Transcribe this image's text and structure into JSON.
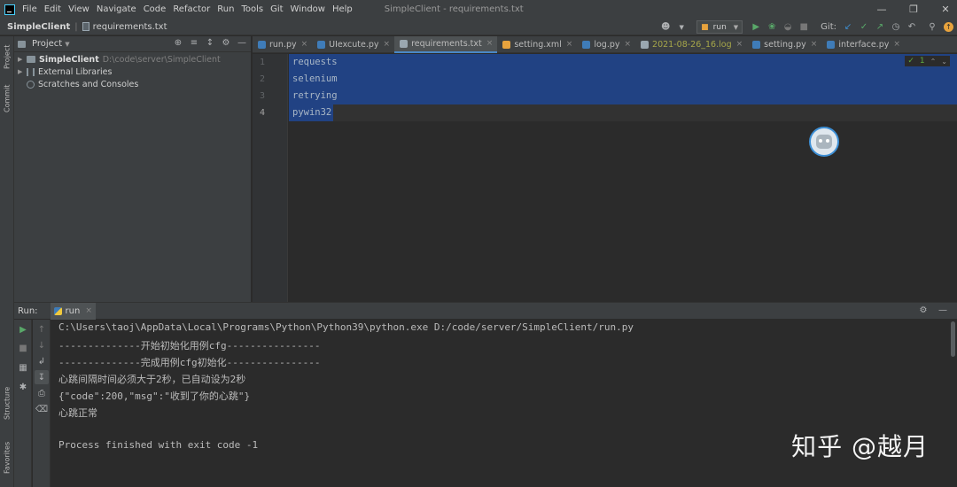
{
  "menubar": {
    "items": [
      "File",
      "Edit",
      "View",
      "Navigate",
      "Code",
      "Refactor",
      "Run",
      "Tools",
      "Git",
      "Window",
      "Help"
    ],
    "window_title": "SimpleClient - requirements.txt"
  },
  "navbar": {
    "project": "SimpleClient",
    "file": "requirements.txt"
  },
  "toolbar": {
    "run_config": "run",
    "git_label": "Git:"
  },
  "left_strip": {
    "project": "Project",
    "commit": "Commit",
    "structure": "Structure",
    "favorites": "Favorites"
  },
  "project_panel": {
    "title": "Project",
    "tree": [
      {
        "name": "SimpleClient",
        "path": "D:\\code\\server\\SimpleClient"
      },
      {
        "name": "External Libraries"
      },
      {
        "name": "Scratches and Consoles"
      }
    ]
  },
  "tabs": [
    {
      "label": "run.py",
      "color": "#3f7cb8"
    },
    {
      "label": "UIexcute.py",
      "color": "#3f7cb8"
    },
    {
      "label": "requirements.txt",
      "color": "#9aa7b0"
    },
    {
      "label": "setting.xml",
      "color": "#e8a33d"
    },
    {
      "label": "log.py",
      "color": "#3f7cb8"
    },
    {
      "label": "2021-08-26_16.log",
      "color": "#9aa7b0"
    },
    {
      "label": "setting.py",
      "color": "#3f7cb8"
    },
    {
      "label": "interface.py",
      "color": "#3f7cb8"
    }
  ],
  "editor": {
    "line_numbers": [
      "1",
      "2",
      "3",
      "4"
    ],
    "lines": [
      "requests",
      "selenium",
      "retrying",
      "pywin32"
    ],
    "inspection_count": "1"
  },
  "run_panel": {
    "label": "Run:",
    "tab": "run",
    "console": [
      "C:\\Users\\taoj\\AppData\\Local\\Programs\\Python\\Python39\\python.exe D:/code/server/SimpleClient/run.py",
      "--------------开始初始化用例cfg----------------",
      "--------------完成用例cfg初始化----------------",
      "心跳间隔时间必须大于2秒，已自动设为2秒",
      "{\"code\":200,\"msg\":\"收到了你的心跳\"}",
      "心跳正常",
      "",
      "Process finished with exit code -1"
    ]
  },
  "watermark": "知乎 @越月"
}
